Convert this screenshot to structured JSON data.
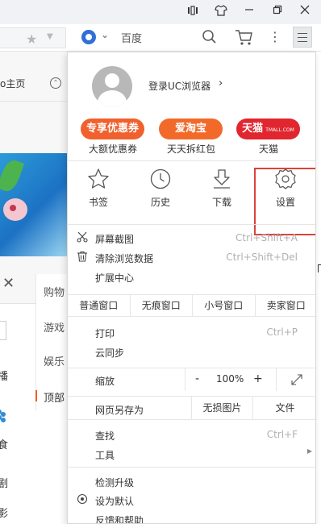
{
  "window_controls": {
    "tiles_icon": "⸽",
    "skin_icon": "tshirt",
    "minimize": "—",
    "restore": "❐",
    "close": "✕"
  },
  "addressbar": {
    "search_engine_text": "百度"
  },
  "background_page": {
    "home_link": "o主页",
    "close_glyph": "✕",
    "side_items": [
      "购物",
      "游戏",
      "娱乐",
      "顶部"
    ],
    "left_edge_glyphs": [
      "播",
      "食",
      "剧",
      "影"
    ]
  },
  "menu": {
    "login": {
      "text": "登录UC浏览器",
      "arrow": "›"
    },
    "promos": [
      {
        "pill": "专享优惠券",
        "caption": "大额优惠券",
        "color": "#f0612d"
      },
      {
        "pill": "爱淘宝",
        "caption": "天天拆红包",
        "color": "#f26a2a"
      },
      {
        "pill": "天猫",
        "pill_sub": "TMALL.COM",
        "caption": "天猫",
        "color": "#e0262f"
      }
    ],
    "tools": [
      {
        "icon": "star-icon",
        "label": "书签"
      },
      {
        "icon": "clock-icon",
        "label": "历史"
      },
      {
        "icon": "download-icon",
        "label": "下载"
      },
      {
        "icon": "gear-icon",
        "label": "设置"
      }
    ],
    "rows_group1": [
      {
        "icon": "scissors-icon",
        "label": "屏幕截图",
        "shortcut": "Ctrl+Shift+A"
      },
      {
        "icon": "trash-icon",
        "label": "清除浏览数据",
        "shortcut": "Ctrl+Shift+Del"
      },
      {
        "icon": "",
        "label": "扩展中心",
        "shortcut": ""
      }
    ],
    "window_modes": [
      "普通窗口",
      "无痕窗口",
      "小号窗口",
      "卖家窗口"
    ],
    "rows_group2": [
      {
        "label": "打印",
        "shortcut": "Ctrl+P"
      },
      {
        "label": "云同步",
        "shortcut": ""
      }
    ],
    "zoom": {
      "label": "缩放",
      "minus": "-",
      "value": "100%",
      "plus": "+"
    },
    "save_row": {
      "label": "网页另存为",
      "button1": "无损图片",
      "button2": "文件"
    },
    "rows_group3": [
      {
        "label": "查找",
        "shortcut": "Ctrl+F",
        "has_arrow": false
      },
      {
        "label": "工具",
        "shortcut": "",
        "has_arrow": true
      }
    ],
    "rows_group4": [
      {
        "icon": "",
        "label": "检测升级"
      },
      {
        "icon": "radio-icon",
        "label": "设为默认"
      },
      {
        "icon": "",
        "label": "反馈和帮助"
      }
    ],
    "highlight_color": "#d9433b"
  }
}
